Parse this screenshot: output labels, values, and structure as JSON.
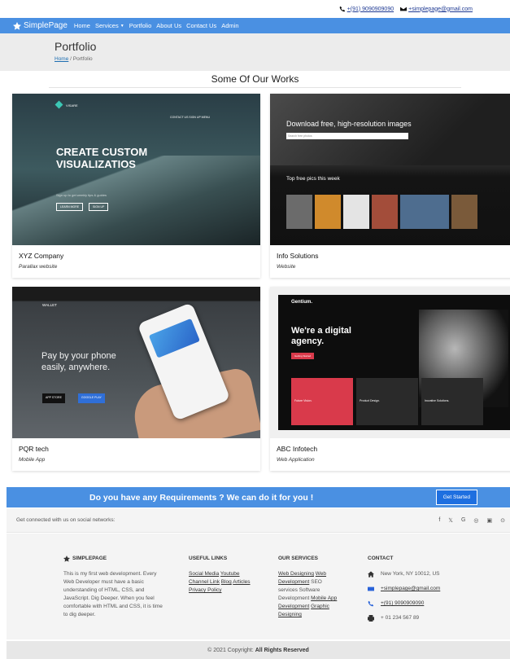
{
  "topbar": {
    "phone": "+(91) 9090909090",
    "email": "+simplepage@gmail.com"
  },
  "nav": {
    "brand": "SimplePage",
    "links": [
      "Home",
      "Services",
      "Portfolio",
      "About Us",
      "Contact Us",
      "Admin"
    ]
  },
  "header": {
    "title": "Portfolio",
    "crumb_home": "Home",
    "crumb_sep": "/",
    "crumb_current": "Portfolio"
  },
  "section_title": "Some Of Our Works",
  "works": [
    {
      "name": "XYZ Company",
      "type": "Parallax website",
      "thumb": {
        "logo": "VISARE",
        "menu": "CONTACT US    SIGN UP    MENU",
        "headline": "CREATE CUSTOM VISUALIZATIOS",
        "sub": "Sign up to get weekly tips & guides",
        "btn1": "LEARN MORE",
        "btn2": "SIGN UP"
      }
    },
    {
      "name": "Info Solutions",
      "type": "Website",
      "thumb": {
        "title": "Download free, high-resolution images",
        "search": "Search free photos",
        "week": "Top free pics this week"
      }
    },
    {
      "name": "PQR tech",
      "type": "Mobile App",
      "thumb": {
        "brand": "WALLET",
        "line1": "Pay by your phone",
        "line2": "easily, anywhere.",
        "store1": "APP STORE",
        "store2": "GOOGLE PLAY"
      }
    },
    {
      "name": "ABC Infotech",
      "type": "Web Application",
      "thumb": {
        "brand": "Gentium.",
        "line1": "We're a digital",
        "line2": "agency.",
        "btn": "Getting Started",
        "box1": "Future Vision.",
        "box2": "Product Design.",
        "box3": "Inovative Solutions."
      }
    }
  ],
  "cta": {
    "text": "Do you have any Requirements ? We can do it for you !",
    "button": "Get Started"
  },
  "social": {
    "text": "Get connected with us on social networks:",
    "icons": [
      "facebook-icon",
      "twitter-icon",
      "google-icon",
      "instagram-icon",
      "linkedin-icon",
      "github-icon"
    ],
    "glyphs": [
      "f",
      "𝕏",
      "G",
      "◎",
      "▣",
      "⊙"
    ]
  },
  "footer": {
    "about_title": "SIMPLEPAGE",
    "about_text": "This is my first web development. Every Web Developer must have a basic understanding of HTML, CSS, and JavaScript. Dig Deeper. When you feel comfortable with HTML and CSS, it is time to dig deeper.",
    "links_title": "USEFUL LINKS",
    "links": [
      "Social Media",
      "Youtube",
      "Channel Link",
      "Blog",
      "Articles",
      "Privacy Policy"
    ],
    "services_title": "OUR SERVICES",
    "services": [
      "Web Designing",
      "Web Development",
      "SEO services",
      "Software Development",
      "Mobile App Development",
      "Graphic Designing"
    ],
    "contact_title": "CONTACT",
    "address": "New York, NY 10012, US",
    "email": "+simplepage@gmail.com",
    "phone": "+(91) 9090909090",
    "fax": "+ 01 234 567 89"
  },
  "copyright": {
    "prefix": "© 2021 Copyright:",
    "strong": "All Rights Reserved"
  }
}
